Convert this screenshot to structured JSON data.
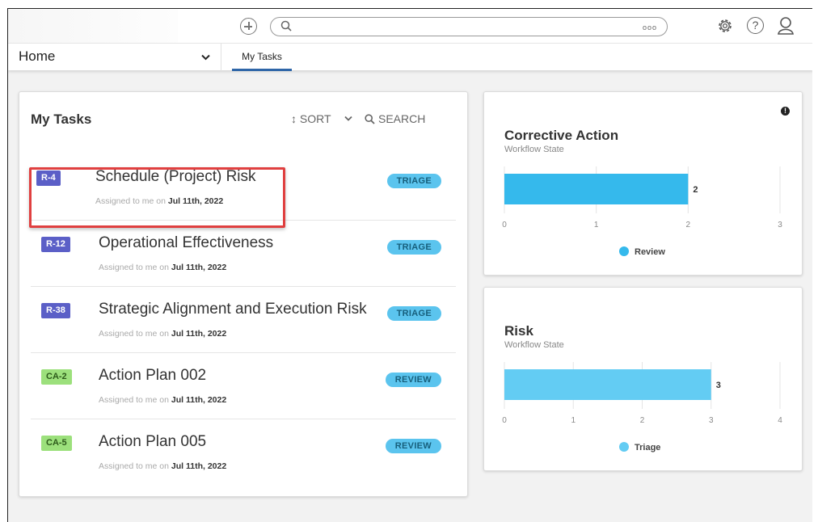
{
  "header": {
    "add_icon": "plus-circle-icon",
    "search_icon": "search-icon",
    "search_options_label": "ooo",
    "settings_icon": "gear-icon",
    "help_label": "?",
    "profile_icon": "user-icon"
  },
  "nav": {
    "home_label": "Home",
    "tabs": [
      {
        "label": "My Tasks",
        "active": true
      }
    ]
  },
  "tasks_panel": {
    "title": "My Tasks",
    "sort_label": "↕ SORT",
    "search_label": "SEARCH",
    "items": [
      {
        "id": "R-4",
        "kind": "risk",
        "title": "Schedule (Project) Risk",
        "assigned_prefix": "Assigned to me on",
        "assigned_date": "Jul 11th, 2022",
        "state": "TRIAGE",
        "highlighted": true
      },
      {
        "id": "R-12",
        "kind": "risk",
        "title": "Operational Effectiveness",
        "assigned_prefix": "Assigned to me on",
        "assigned_date": "Jul 11th, 2022",
        "state": "TRIAGE"
      },
      {
        "id": "R-38",
        "kind": "risk",
        "title": "Strategic Alignment and Execution Risk",
        "assigned_prefix": "Assigned to me on",
        "assigned_date": "Jul 11th, 2022",
        "state": "TRIAGE"
      },
      {
        "id": "CA-2",
        "kind": "corrective-action",
        "title": "Action Plan 002",
        "assigned_prefix": "Assigned to me on",
        "assigned_date": "Jul 11th, 2022",
        "state": "REVIEW"
      },
      {
        "id": "CA-5",
        "kind": "corrective-action",
        "title": "Action Plan 005",
        "assigned_prefix": "Assigned to me on",
        "assigned_date": "Jul 11th, 2022",
        "state": "REVIEW"
      }
    ]
  },
  "chart_data": [
    {
      "type": "bar",
      "orientation": "horizontal",
      "title": "Corrective Action",
      "subtitle": "Workflow State",
      "categories": [
        "Review"
      ],
      "series": [
        {
          "name": "Review",
          "values": [
            2
          ],
          "color": "#35b9ec"
        }
      ],
      "data_labels": [
        "2"
      ],
      "xlim": [
        0,
        3
      ],
      "xticks": [
        "0",
        "1",
        "2",
        "3"
      ],
      "legend": "bottom",
      "grid": true,
      "info_icon": "!"
    },
    {
      "type": "bar",
      "orientation": "horizontal",
      "title": "Risk",
      "subtitle": "Workflow State",
      "categories": [
        "Triage"
      ],
      "series": [
        {
          "name": "Triage",
          "values": [
            3
          ],
          "color": "#63ccf3"
        }
      ],
      "data_labels": [
        "3"
      ],
      "xlim": [
        0,
        4
      ],
      "xticks": [
        "0",
        "1",
        "2",
        "3",
        "4"
      ],
      "legend": "bottom",
      "grid": true
    }
  ]
}
